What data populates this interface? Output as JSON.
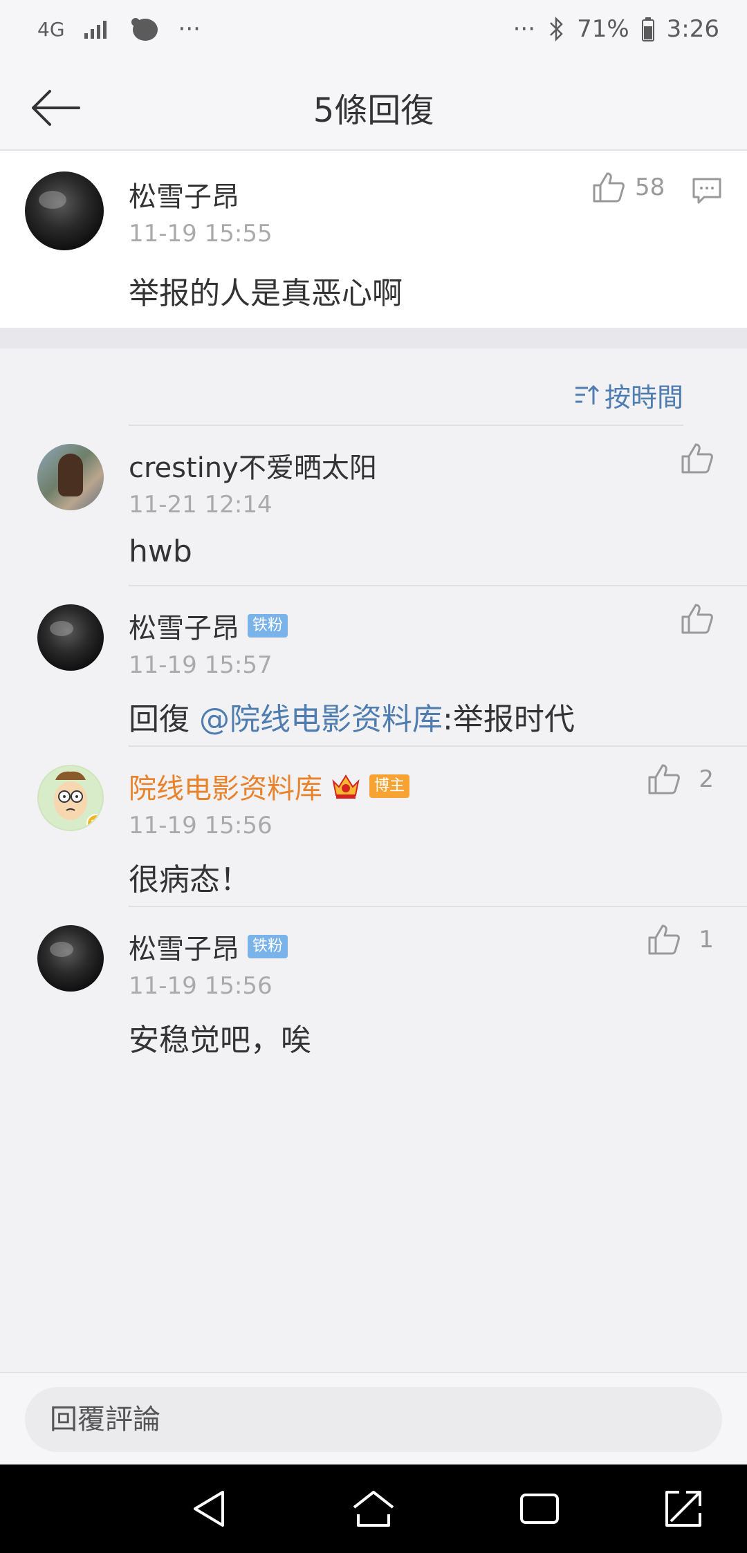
{
  "status_bar": {
    "network": "4G",
    "more_left": "···",
    "more_right": "···",
    "battery": "71%",
    "time": "3:26"
  },
  "header": {
    "title": "5條回復"
  },
  "main_comment": {
    "name": "松雪子昂",
    "time": "11-19 15:55",
    "text": "举报的人是真恶心啊",
    "likes": "58"
  },
  "sort": {
    "label": "按時間"
  },
  "replies": [
    {
      "name": "crestiny不爱晒太阳",
      "time": "11-21 12:14",
      "text": "hwb",
      "likes": ""
    },
    {
      "name": "松雪子昂",
      "badge": "铁粉",
      "time": "11-19 15:57",
      "prefix": "回復 ",
      "mention": "@院线电影资料库",
      "suffix": ":举报时代",
      "likes": ""
    },
    {
      "name": "院线电影资料库",
      "badge": "博主",
      "time": "11-19 15:56",
      "text": "很病态！",
      "likes": "2"
    },
    {
      "name": "松雪子昂",
      "badge": "铁粉",
      "time": "11-19 15:56",
      "text": "安稳觉吧，唉",
      "likes": "1"
    }
  ],
  "input": {
    "placeholder": "回覆評論"
  },
  "colors": {
    "link": "#4f7db0",
    "author_orange": "#e8832c",
    "fan_badge": "#79b3ea",
    "host_badge": "#f6a333"
  }
}
